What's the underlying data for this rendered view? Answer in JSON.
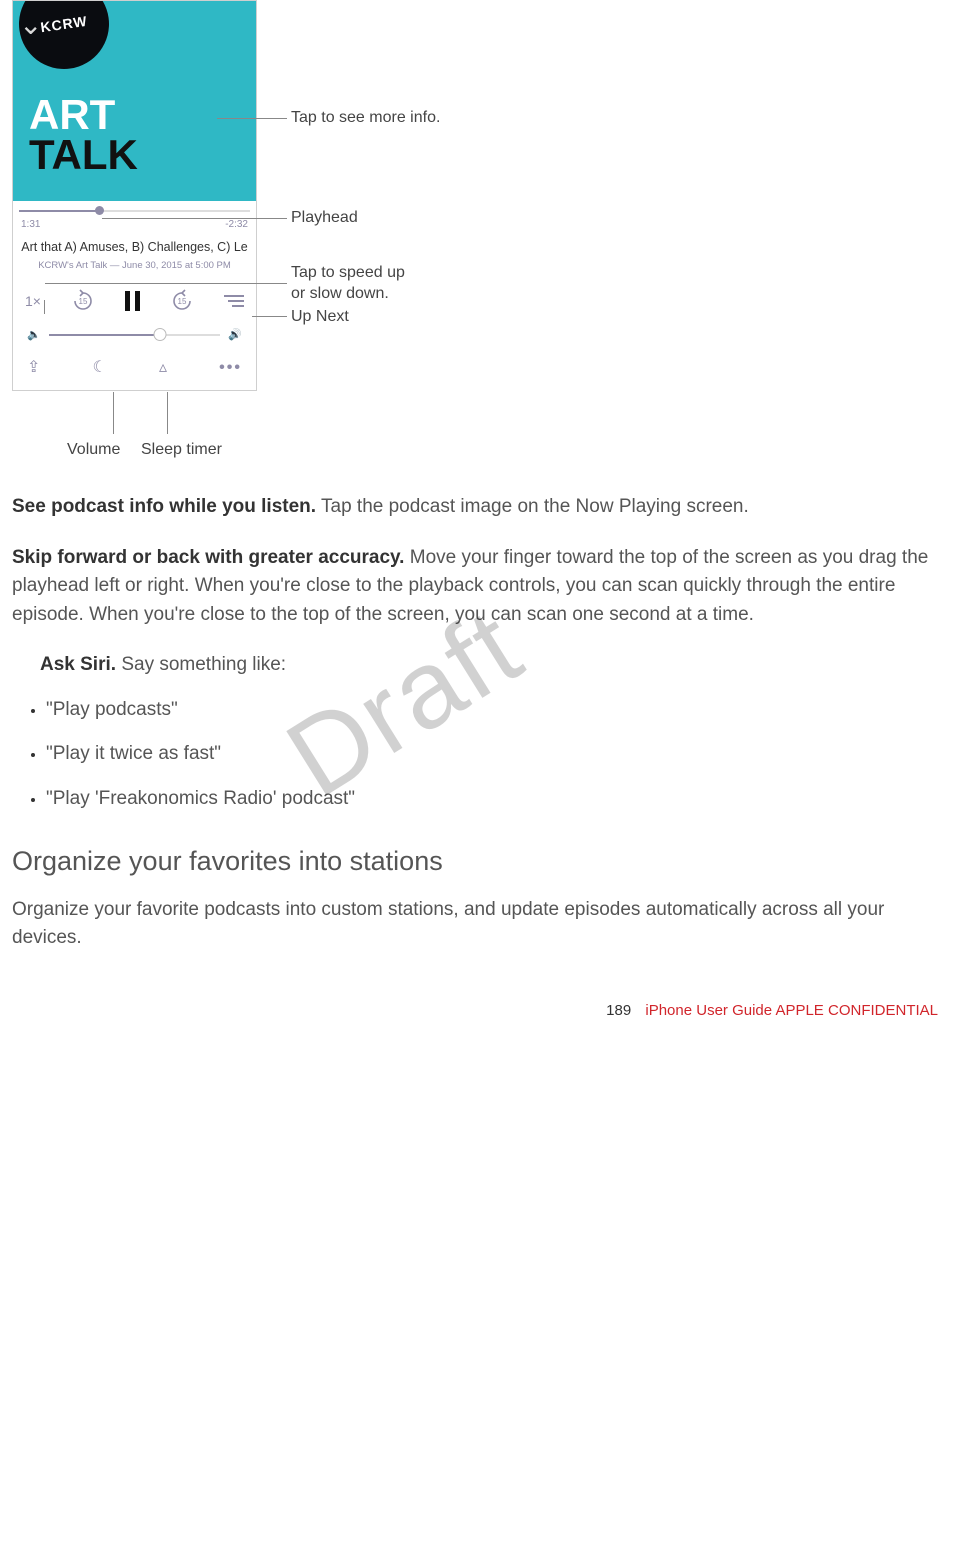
{
  "figure": {
    "kcrw": "KCRW",
    "cover_line1": "ART",
    "cover_line2": "TALK",
    "time_elapsed": "1:31",
    "time_remaining": "-2:32",
    "track_title": "Art that A) Amuses, B) Challenges, C) Le",
    "track_sub": "KCRW's Art Talk — June 30, 2015 at 5:00 PM",
    "speed": "1×",
    "skip_back_label": "15",
    "skip_fwd_label": "15"
  },
  "callouts": {
    "more_info": "Tap to see more info.",
    "playhead": "Playhead",
    "speed_line1": "Tap to speed up",
    "speed_line2": "or slow down.",
    "up_next": "Up Next",
    "volume": "Volume",
    "sleep_timer": "Sleep timer"
  },
  "para1_bold": "See podcast info while you listen.",
  "para1_rest": " Tap the podcast image on the Now Playing screen.",
  "para2_bold": "Skip forward or back with greater accuracy.",
  "para2_rest": " Move your finger toward the top of the screen as you drag the playhead left or right. When you're close to the playback controls, you can scan quickly through the entire episode. When you're close to the top of the screen, you can scan one second at a time.",
  "siri_bold": "Ask Siri.",
  "siri_rest": " Say something like:",
  "siri_items": [
    "\"Play podcasts\"",
    "\"Play it twice as fast\"",
    "\"Play 'Freakonomics Radio' podcast\""
  ],
  "section_heading": "Organize your favorites into stations",
  "section_para": "Organize your favorite podcasts into custom stations, and update episodes automatically across all your devices.",
  "watermark": "Draft",
  "footer_page": "189",
  "footer_text": "iPhone User Guide  APPLE CONFIDENTIAL"
}
